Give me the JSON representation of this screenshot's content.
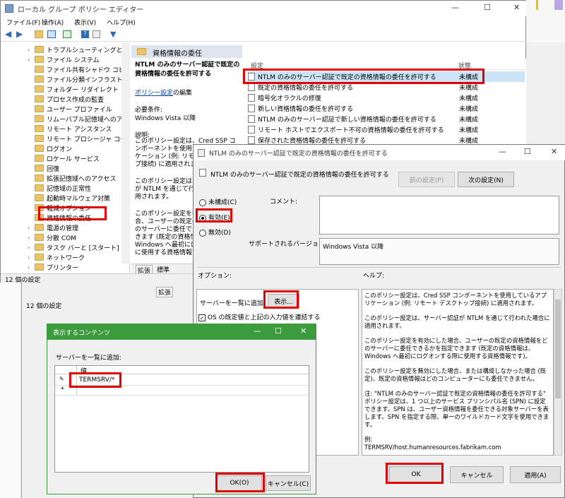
{
  "main_window": {
    "title": "ローカル グループ ポリシー エディター",
    "controls": [
      "—",
      "☐",
      "✕"
    ],
    "menu": [
      "ファイル(F)",
      "操作(A)",
      "表示(V)",
      "ヘルプ(H)"
    ],
    "status": "12 個の設定"
  },
  "tree": {
    "items": [
      {
        "label": "トラブルシューティングと診",
        "expander": "›"
      },
      {
        "label": "ファイル システム",
        "expander": "›"
      },
      {
        "label": "ファイル共有シャドウ コピ",
        "expander": ""
      },
      {
        "label": "ファイル分類インフラストラ",
        "expander": ""
      },
      {
        "label": "フォルダー リダイレクト",
        "expander": ""
      },
      {
        "label": "プロセス作成の監査",
        "expander": ""
      },
      {
        "label": "ユーザー プロファイル",
        "expander": ""
      },
      {
        "label": "リムーバブル記憶域へのア",
        "expander": ""
      },
      {
        "label": "リモート アシスタンス",
        "expander": ""
      },
      {
        "label": "リモート プロシージャ コール",
        "expander": ""
      },
      {
        "label": "ログオン",
        "expander": ""
      },
      {
        "label": "ロケール サービス",
        "expander": ""
      },
      {
        "label": "回復",
        "expander": ""
      },
      {
        "label": "拡張記憶域へのアクセス",
        "expander": ""
      },
      {
        "label": "記憶域の正常性",
        "expander": ""
      },
      {
        "label": "起動時マルウェア対策",
        "expander": ""
      },
      {
        "label": "軽減オプション",
        "expander": ""
      },
      {
        "label": "資格情報の委任",
        "expander": ""
      },
      {
        "label": "電源の管理",
        "expander": "›"
      },
      {
        "label": "分散 COM",
        "expander": "›"
      },
      {
        "label": "タスク バーと [スタート] メニュー",
        "expander": "›"
      },
      {
        "label": "ネットワーク",
        "expander": "›"
      },
      {
        "label": "プリンター",
        "expander": "›"
      }
    ]
  },
  "middle": {
    "header": "資格情報の委任",
    "policy_title": "NTLM のみのサーバー認証で既定の資格情報の委任を許可する",
    "edit_link": "ポリシー設定",
    "edit_suffix": "の編集",
    "req_label": "必要条件:",
    "req_value": "Windows Vista 以降",
    "desc_label": "説明:",
    "desc1": "このポリシー設定は、Cred SSP コンポーネントを使用しているアプリケーション (例: リモート デスクトップ接続) に適用されます。",
    "desc2": "このポリシー設定は、サーバー認証が NTLM を通じて行われた場合に適用されます。",
    "desc3": "このポリシー設定を有効にした場合、ユーザーの既定の資格情報をどのサーバーに委任できるかを指定できます (既定の資格情報は、Windows へ最初にログオンする際に使用する資格情報です)。",
    "tabs": [
      "拡張",
      "標準"
    ]
  },
  "list": {
    "col_setting": "設定",
    "col_state": "状態",
    "rows": [
      {
        "name": "NTLM のみのサーバー認証で既定の資格情報の委任を許可する",
        "state": "未構成"
      },
      {
        "name": "既定の資格情報の委任を許可する",
        "state": "未構成"
      },
      {
        "name": "暗号化オラクルの修復",
        "state": "未構成"
      },
      {
        "name": "新しい資格情報の委任を許可する",
        "state": "未構成"
      },
      {
        "name": "NTLM のみのサーバー認証で新しい資格情報の委任を許可する",
        "state": "未構成"
      },
      {
        "name": "リモート ホストでエクスポート不可の資格情報の委任を許可する",
        "state": "未構成"
      },
      {
        "name": "保存された資格情報の委任を許可する",
        "state": "未構成"
      }
    ]
  },
  "back_window": {
    "tab_label": "拡張",
    "status": "12 個の設定"
  },
  "policy_dialog": {
    "title": "NTLM のみのサーバー認証で既定の資格情報の委任を許可する",
    "controls": [
      "—",
      "☐",
      "✕"
    ],
    "subheader": "NTLM のみのサーバー認証で既定の資格情報の委任を許可する",
    "prev_button": "前の設定(P)",
    "next_button": "次の設定(N)",
    "radio_not_configured": "未構成(C)",
    "radio_enabled": "有効(E)",
    "radio_disabled": "無効(D)",
    "comment_label": "コメント:",
    "supported_label": "サポートされるバージョン:",
    "supported_value": "Windows Vista 以降",
    "options_label": "オプション:",
    "help_label": "ヘルプ:",
    "add_servers_label": "サーバーを一覧に追加:",
    "show_button": "表示...",
    "concat_checkbox": "OS の既定値と上記の入力値を連結する",
    "help": [
      "このポリシー設定は、Cred SSP コンポーネントを使用しているアプリケーション (例: リモート デスクトップ接続) に適用されます。",
      "このポリシー設定は、サーバー認証が NTLM を通じて行われた場合に適用されます。",
      "このポリシー設定を有効にした場合、ユーザーの既定の資格情報をどのサーバーに委任できるかを指定できます (既定の資格情報は、Windows へ最初にログオンする際に使用する資格情報です)。",
      "このポリシー設定を無効にした場合、または構成しなかった場合 (既定)、既定の資格情報はどのコンピューターにも委任できません。",
      "注: \"NTLM のみのサーバー認証で既定の資格情報の委任を許可する\" ポリシー設定は、1 つ以上のサービス プリンシパル名 (SPN) に設定できます。SPN は、ユーザー資格情報を委任できる対象サーバーを表します。SPN を指定する際、単一のワイルドカード文字を使用できます。",
      "例:",
      "TERMSRV/host.humanresources.fabrikam.com"
    ],
    "ok_button": "OK",
    "cancel_button": "キャンセル",
    "apply_button": "適用(A)"
  },
  "show_dialog": {
    "title": "表示するコンテンツ",
    "controls": [
      "—",
      "☐",
      "✕"
    ],
    "label": "サーバーを一覧に追加:",
    "col_value": "値",
    "row1_marker": "✎",
    "row1_value": "TERMSRV/*",
    "row2_marker": "*",
    "ok_button": "OK(O)",
    "cancel_button": "キャンセル(C)"
  },
  "colors": {
    "highlight_red": "#e00000",
    "dialog_green": "#3c9b3c",
    "header_blue": "#dde6f0"
  }
}
